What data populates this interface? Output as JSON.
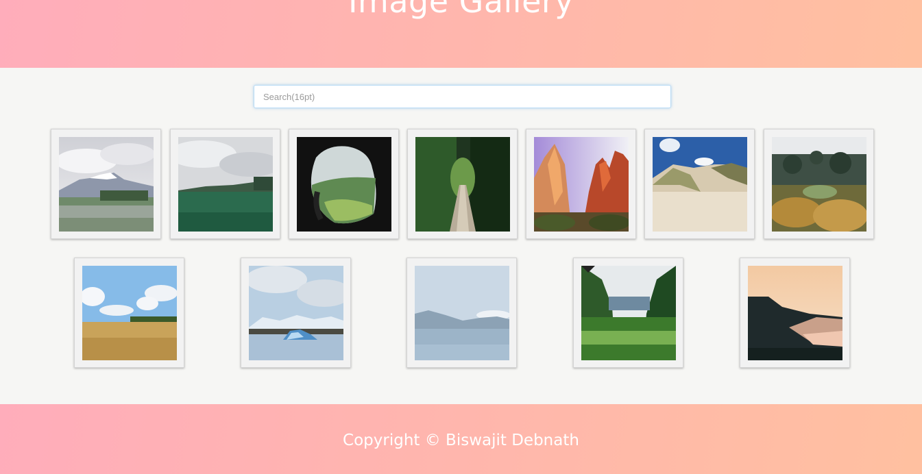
{
  "header": {
    "title": "Image Gallery"
  },
  "search": {
    "placeholder": "Search(16pt)"
  },
  "gallery": {
    "images": [
      {
        "icon": "mountain-meadow-image"
      },
      {
        "icon": "green-field-image"
      },
      {
        "icon": "cave-view-image"
      },
      {
        "icon": "forest-path-image"
      },
      {
        "icon": "red-canyon-image"
      },
      {
        "icon": "sand-dunes-image"
      },
      {
        "icon": "wild-garden-image"
      },
      {
        "icon": "wheat-field-image"
      },
      {
        "icon": "iceberg-lake-image"
      },
      {
        "icon": "calm-lake-image"
      },
      {
        "icon": "jungle-river-image"
      },
      {
        "icon": "coastal-sunset-image"
      }
    ]
  },
  "footer": {
    "copyright": "Copyright © Biswajit Debnath"
  }
}
